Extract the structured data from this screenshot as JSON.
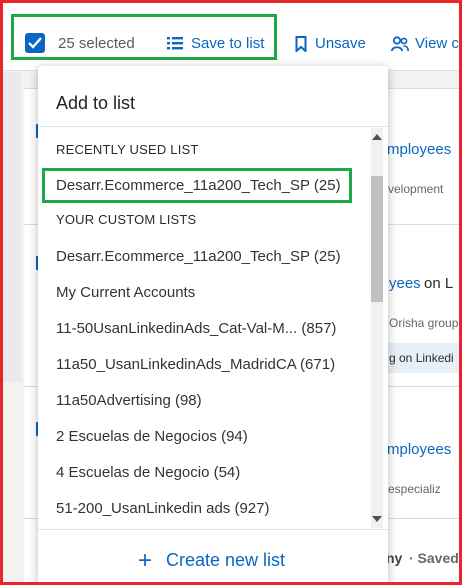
{
  "toolbar": {
    "selected_count": "25 selected",
    "save_to_list": "Save to list",
    "unsave": "Unsave",
    "view": "View c"
  },
  "background": {
    "row1_link": "mployees",
    "row1_sub": "velopment",
    "row2_link": "yees",
    "row2_on": "on L",
    "row2_sub": "Orisha group",
    "row2_badge": "g on Linkedi",
    "row3_link": "mployees",
    "row3_sub": "especializ",
    "row4_name": "ny",
    "row4_saved": "· Saved"
  },
  "dropdown": {
    "title": "Add to list",
    "recent_header": "RECENTLY USED LIST",
    "recent_items": [
      "Desarr.Ecommerce_11a200_Tech_SP (25)"
    ],
    "custom_header": "YOUR CUSTOM LISTS",
    "custom_items": [
      "Desarr.Ecommerce_11a200_Tech_SP (25)",
      "My Current Accounts",
      "11-50UsanLinkedinAds_Cat-Val-M... (857)",
      "11a50_UsanLinkedinAds_MadridCA (671)",
      "11a50Advertising (98)",
      "2 Escuelas de Negocios (94)",
      "4 Escuelas de Negocio (54)",
      "51-200_UsanLinkedin ads (927)"
    ],
    "create_new": "Create new list"
  },
  "colors": {
    "accent": "#0a66c2",
    "highlight_green": "#1fa84a",
    "frame_red": "#e8252b"
  }
}
